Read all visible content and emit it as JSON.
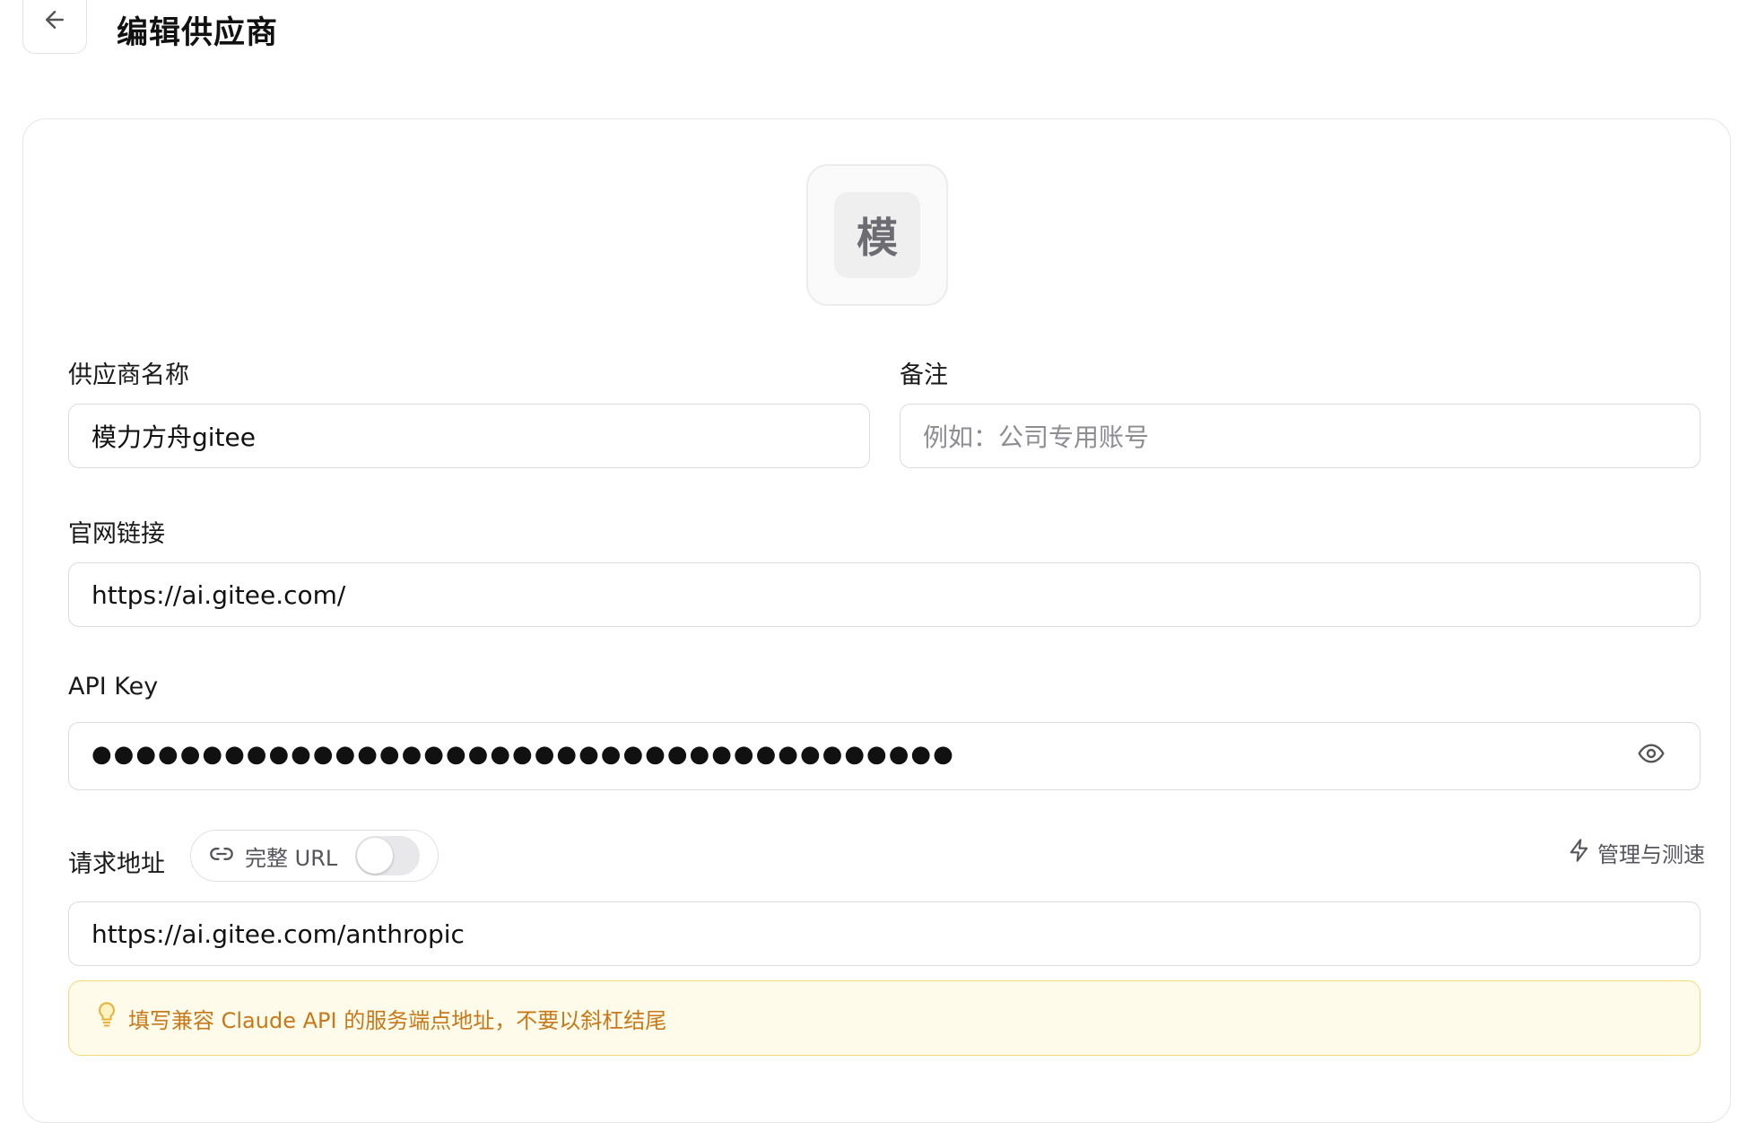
{
  "header": {
    "title": "编辑供应商"
  },
  "logo": {
    "letter": "模"
  },
  "form": {
    "name": {
      "label": "供应商名称",
      "value": "模力方舟gitee"
    },
    "note": {
      "label": "备注",
      "placeholder": "例如：公司专用账号"
    },
    "website": {
      "label": "官网链接",
      "value": "https://ai.gitee.com/"
    },
    "api_key": {
      "label": "API Key",
      "masked_value": "●●●●●●●●●●●●●●●●●●●●●●●●●●●●●●●●●●●●●●●"
    },
    "endpoint": {
      "label": "请求地址",
      "full_url_label": "完整 URL",
      "full_url_enabled": false,
      "manage_label": "管理与测速",
      "value": "https://ai.gitee.com/anthropic",
      "hint": "填写兼容 Claude API 的服务端点地址，不要以斜杠结尾"
    }
  },
  "colors": {
    "hint_text": "#c7791a",
    "hint_bg": "#fffbea",
    "hint_border": "#f3d978",
    "toggle_off": "#e8e8eb"
  },
  "icons": {
    "back": "arrow-left-icon",
    "eye": "eye-icon",
    "link": "link-icon",
    "bolt": "lightning-icon",
    "bulb": "lightbulb-icon"
  }
}
